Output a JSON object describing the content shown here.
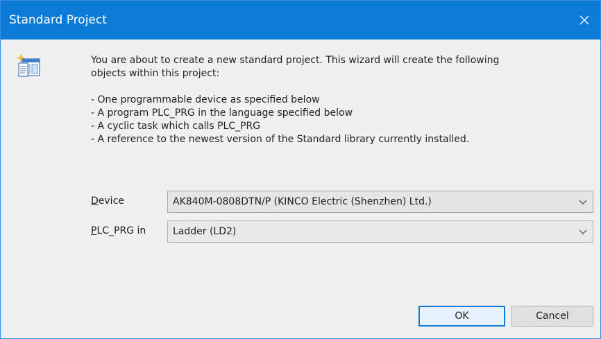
{
  "window": {
    "title": "Standard Project",
    "accent_color": "#0c7bd8"
  },
  "description": {
    "intro": [
      "You are about to create a new standard project. This wizard will create the following",
      "objects within this project:"
    ],
    "items": [
      "- One programmable device as specified below",
      "- A program PLC_PRG in the language specified below",
      "- A cyclic task which calls PLC_PRG",
      "- A reference to the newest version of the Standard library currently installed."
    ]
  },
  "form": {
    "device": {
      "label_access_key": "D",
      "label_rest": "evice",
      "selected": "AK840M-0808DTN/P (KINCO Electric (Shenzhen) Ltd.)"
    },
    "plc_prg": {
      "label_access_key": "P",
      "label_rest": "LC_PRG in",
      "selected": "Ladder (LD2)"
    }
  },
  "buttons": {
    "ok": "OK",
    "cancel": "Cancel"
  },
  "icons": {
    "close": "close-icon",
    "wizard": "project-wizard-icon",
    "dropdown": "chevron-down-icon"
  }
}
